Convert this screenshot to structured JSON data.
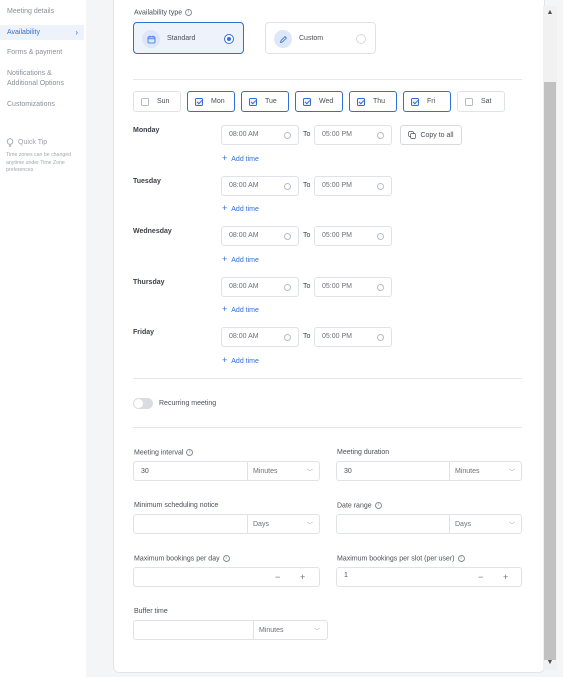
{
  "sidebar": {
    "items": [
      {
        "label": "Meeting details"
      },
      {
        "label": "Availability"
      },
      {
        "label": "Forms & payment"
      },
      {
        "label": "Notifications & Additional Options"
      },
      {
        "label": "Customizations"
      }
    ],
    "tip_title": "Quick Tip",
    "tip_text": "Time zones can be changed anytime under Time Zone preferences"
  },
  "availability_type": {
    "label": "Availability type",
    "options": [
      {
        "label": "Standard",
        "selected": true,
        "icon": "calendar-icon"
      },
      {
        "label": "Custom",
        "selected": false,
        "icon": "pencil-icon"
      }
    ]
  },
  "days": [
    {
      "label": "Sun",
      "checked": false
    },
    {
      "label": "Mon",
      "checked": true
    },
    {
      "label": "Tue",
      "checked": true
    },
    {
      "label": "Wed",
      "checked": true
    },
    {
      "label": "Thu",
      "checked": true
    },
    {
      "label": "Fri",
      "checked": true
    },
    {
      "label": "Sat",
      "checked": false
    }
  ],
  "schedule": [
    {
      "day": "Monday",
      "start": "08:00 AM",
      "to": "To",
      "end": "05:00 PM",
      "add": "Add time"
    },
    {
      "day": "Tuesday",
      "start": "08:00 AM",
      "to": "To",
      "end": "05:00 PM",
      "add": "Add time"
    },
    {
      "day": "Wednesday",
      "start": "08:00 AM",
      "to": "To",
      "end": "05:00 PM",
      "add": "Add time"
    },
    {
      "day": "Thursday",
      "start": "08:00 AM",
      "to": "To",
      "end": "05:00 PM",
      "add": "Add time"
    },
    {
      "day": "Friday",
      "start": "08:00 AM",
      "to": "To",
      "end": "05:00 PM",
      "add": "Add time"
    }
  ],
  "copy_to_all": "Copy to all",
  "recurring": {
    "label": "Recurring meeting",
    "on": false
  },
  "meeting_interval": {
    "label": "Meeting interval",
    "value": "30",
    "unit": "Minutes"
  },
  "meeting_duration": {
    "label": "Meeting duration",
    "value": "30",
    "unit": "Minutes"
  },
  "min_notice": {
    "label": "Minimum scheduling notice",
    "value": "",
    "unit": "Days"
  },
  "date_range": {
    "label": "Date range",
    "value": "",
    "unit": "Days"
  },
  "max_per_day": {
    "label": "Maximum bookings per day",
    "value": ""
  },
  "max_per_slot": {
    "label": "Maximum bookings per slot (per user)",
    "value": "1"
  },
  "buffer_time": {
    "label": "Buffer time",
    "value": "",
    "unit": "Minutes"
  },
  "colors": {
    "accent": "#2f6fd6",
    "border": "#dfe2e6",
    "muted": "#8a8f98"
  }
}
